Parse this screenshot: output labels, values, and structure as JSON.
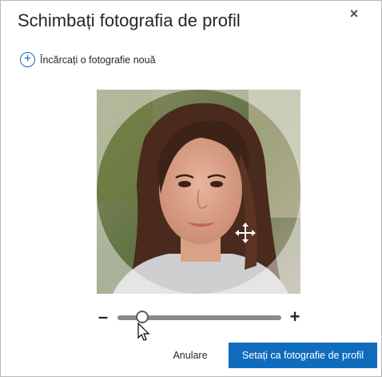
{
  "dialog": {
    "title": "Schimbați fotografia de profil",
    "close_glyph": "×",
    "close_icon": "close-icon"
  },
  "upload": {
    "icon_glyph": "+",
    "icon": "add-circle-icon",
    "label": "Încărcați o fotografie nouă"
  },
  "editor": {
    "move_icon": "move-arrows-icon",
    "zoom_minus": "–",
    "zoom_plus": "+",
    "zoom_level": 0.12
  },
  "footer": {
    "cancel_label": "Anulare",
    "primary_label": "Setați ca fotografie de profil"
  },
  "colors": {
    "accent": "#0f6cbd",
    "text": "#262626"
  }
}
